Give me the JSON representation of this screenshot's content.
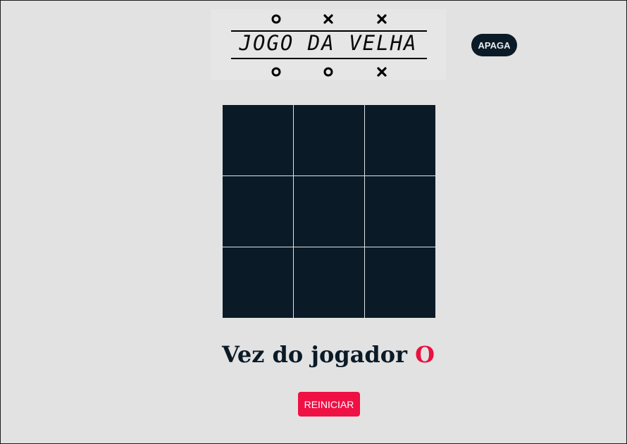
{
  "logo": {
    "title": "JOGO DA VELHA",
    "top_marks": [
      "O",
      "X",
      "X"
    ],
    "bottom_marks": [
      "O",
      "O",
      "X"
    ]
  },
  "toolbar": {
    "apaga_label": "APAGA"
  },
  "board": {
    "cells": [
      "",
      "",
      "",
      "",
      "",
      "",
      "",
      "",
      ""
    ]
  },
  "status": {
    "prefix": "Vez do jogador",
    "player": "O"
  },
  "actions": {
    "reiniciar_label": "REINICIAR"
  },
  "colors": {
    "background": "#e2e2e2",
    "board": "#0b1a27",
    "accent": "#ef1044"
  }
}
